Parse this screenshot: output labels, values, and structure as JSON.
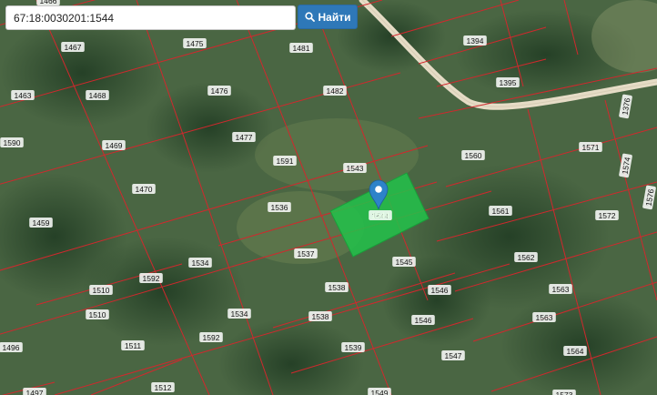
{
  "search": {
    "value": "67:18:0030201:1544",
    "button_label": "Найти",
    "button_icon": "search-icon"
  },
  "map": {
    "selected_parcel": "1544",
    "colors": {
      "parcel_border": "#d1282d",
      "selected_fill": "#22c24a",
      "marker": "#2d83c9",
      "road": "#e6dcc6"
    },
    "parcels": [
      "1466",
      "1467",
      "1475",
      "1481",
      "1394",
      "1395",
      "1463",
      "1468",
      "1476",
      "1482",
      "1376",
      "1590",
      "1469",
      "1477",
      "1591",
      "1543",
      "1560",
      "1571",
      "1470",
      "1536",
      "1544",
      "1561",
      "1572",
      "1459",
      "1537",
      "1545",
      "1562",
      "1534",
      "1592",
      "1510",
      "1546",
      "1538",
      "1563",
      "1510",
      "1534",
      "1538",
      "1546",
      "1563",
      "1496",
      "1511",
      "1592",
      "1539",
      "1564",
      "1547",
      "1512",
      "1497",
      "1549",
      "1573",
      "1574",
      "1576"
    ]
  }
}
